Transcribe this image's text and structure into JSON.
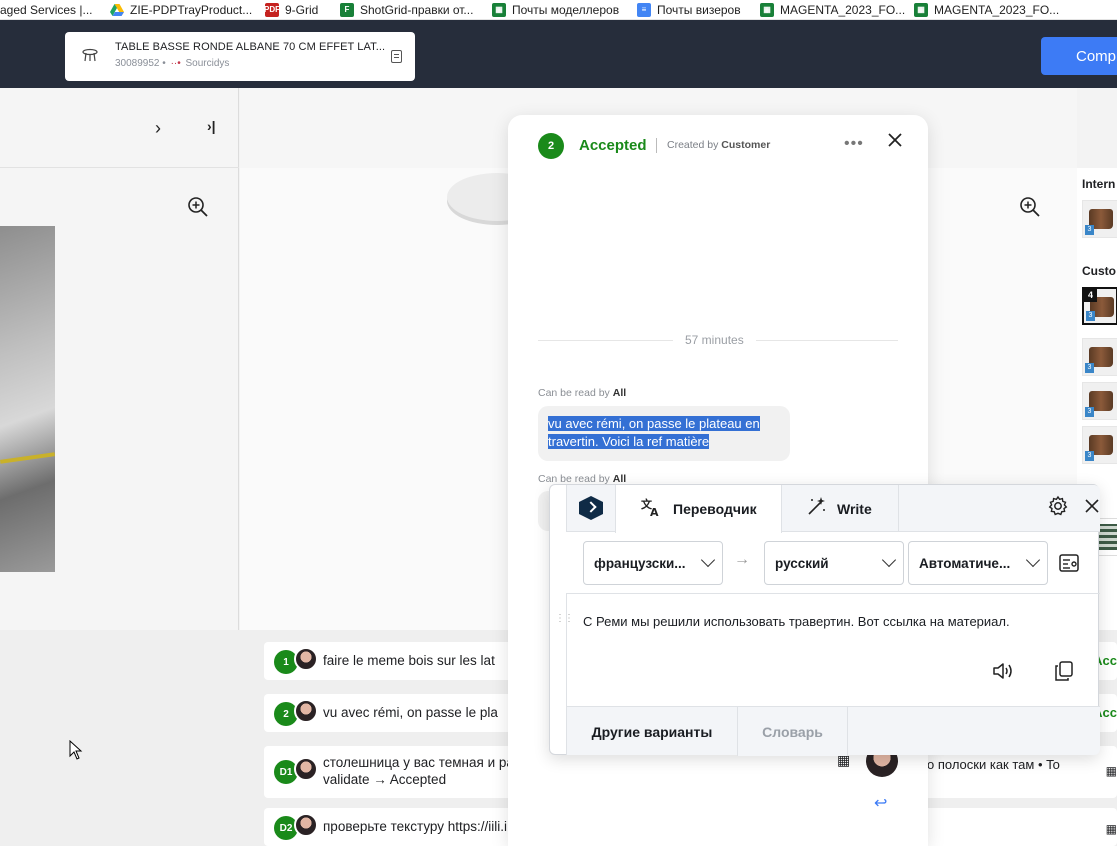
{
  "bookmarks": [
    {
      "label": "aged Services |...",
      "icon": "page-icon",
      "color": "#ffffff"
    },
    {
      "label": "ZIE-PDPTrayProduct...",
      "icon": "google-drive-icon",
      "color": "#1fa463"
    },
    {
      "label": "9-Grid",
      "icon": "pdf-icon",
      "color": "#c5221f"
    },
    {
      "label": "ShotGrid-правки от...",
      "icon": "sheet-f-icon",
      "color": "#188038"
    },
    {
      "label": "Почты моделлеров",
      "icon": "sheets-icon",
      "color": "#188038"
    },
    {
      "label": "Почты визеров",
      "icon": "docs-icon",
      "color": "#4285f4"
    },
    {
      "label": "MAGENTA_2023_FO...",
      "icon": "sheets-icon",
      "color": "#188038"
    },
    {
      "label": "MAGENTA_2023_FO...",
      "icon": "sheets-icon",
      "color": "#188038"
    }
  ],
  "product": {
    "title": "TABLE BASSE RONDE ALBANE 70 CM EFFET LAT...",
    "id": "30089952",
    "supplier": "Sourcidys"
  },
  "header": {
    "compare_label": "Comp"
  },
  "right_sidebar": {
    "internal_label": "Intern",
    "customer_label": "Custo",
    "selected_badge": "4",
    "thumb_badge": "3"
  },
  "panel": {
    "number": "2",
    "status": "Accepted",
    "created_prefix": "Created by",
    "created_by": "Customer",
    "time_separator": "57 minutes",
    "read_prefix": "Can be read by",
    "read_scope": "All",
    "message": "vu avec rémi, on passe le plateau en travertin. Voici la ref matière"
  },
  "translator": {
    "tab_translator": "Переводчик",
    "tab_write": "Write",
    "source_lang": "французски...",
    "target_lang": "русский",
    "style": "Автоматиче...",
    "result": "С Реми мы решили использовать травертин. Вот ссылка на материал.",
    "btn_alternatives": "Другие варианты",
    "btn_dictionary": "Словарь"
  },
  "comments": [
    {
      "number": "1",
      "text": "faire le meme bois sur les lat",
      "status": "Acc"
    },
    {
      "number": "2",
      "text": "vu avec rémi, on passe le pla",
      "status": "Acc"
    },
    {
      "number": "D1",
      "text": "столешница у вас темная и раз",
      "text2": "validate → Accepted",
      "right": "о полоски как там • To"
    },
    {
      "number": "D2",
      "text": "проверьте текстуру https://iili.i"
    }
  ],
  "colors": {
    "accent_green": "#1a8a1a",
    "primary_blue": "#3d7bf5",
    "header_dark": "#262d3b",
    "highlight": "#3470d4"
  }
}
